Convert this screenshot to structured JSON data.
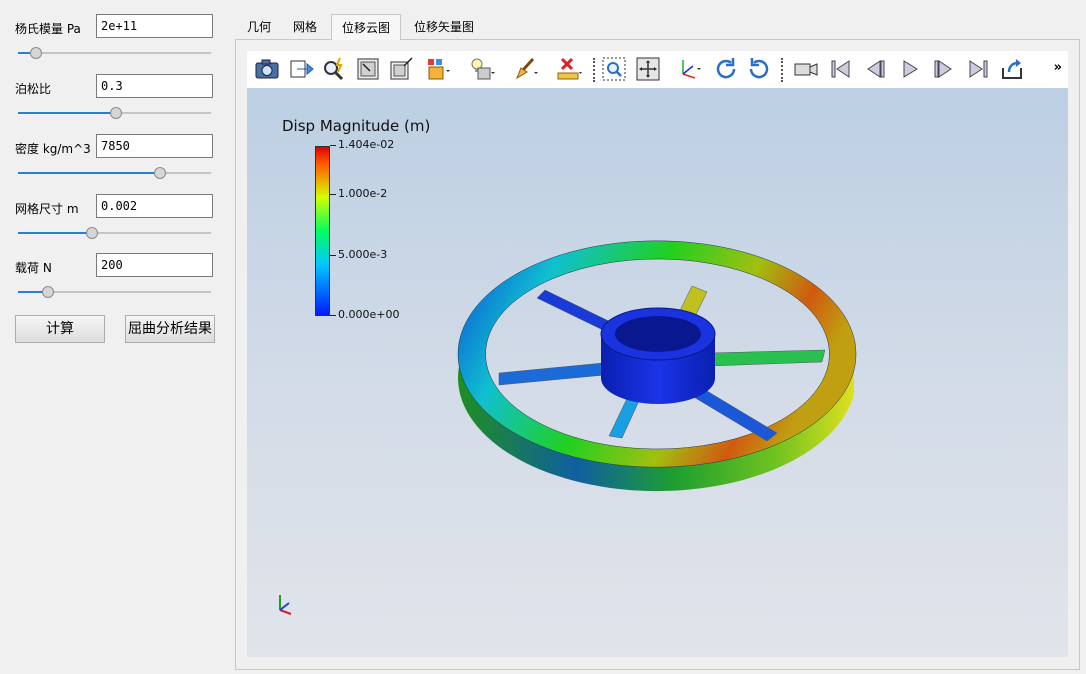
{
  "params": [
    {
      "label": "杨氏模量 Pa",
      "value": "2e+11",
      "slider": 0.09
    },
    {
      "label": "泊松比",
      "value": "0.3",
      "slider": 0.5
    },
    {
      "label": "密度 kg/m^3",
      "value": "7850",
      "slider": 0.73
    },
    {
      "label": "网格尺寸 m",
      "value": "0.002",
      "slider": 0.38
    },
    {
      "label": "载荷 N",
      "value": "200",
      "slider": 0.15
    }
  ],
  "buttons": {
    "compute": "计算",
    "buckling": "屈曲分析结果"
  },
  "tabs": [
    "几何",
    "网格",
    "位移云图",
    "位移矢量图"
  ],
  "active_tab": "位移云图",
  "toolbar": {
    "icons": [
      "camera-icon",
      "export-arrow-icon",
      "interactive-select-icon",
      "zoom-to-box-icon",
      "reset-window-icon",
      "boxes-dropdown-icon",
      "light-bulb-dropdown-icon",
      "paint-brush-dropdown-icon",
      "ruler-delete-dropdown-icon",
      "zoom-region-icon",
      "fit-view-icon",
      "axes-dropdown-icon",
      "rotate-cw-icon",
      "rotate-ccw-icon",
      "video-camera-icon",
      "first-frame-icon",
      "prev-frame-icon",
      "play-icon",
      "next-frame-icon",
      "last-frame-icon",
      "loop-icon"
    ],
    "more": "»"
  },
  "legend": {
    "title": "Disp Magnitude (m)",
    "ticks": [
      "1.404e-02",
      "1.000e-2",
      "5.000e-3",
      "0.000e+00"
    ],
    "colors": [
      "#e00000",
      "#ff5a00",
      "#d4ff00",
      "#00ff60",
      "#00c8ff",
      "#0019ff"
    ]
  }
}
